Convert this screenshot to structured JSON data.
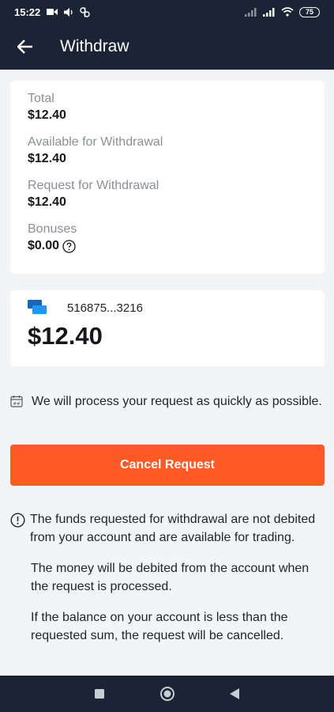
{
  "status_bar": {
    "time": "15:22",
    "battery": "75"
  },
  "app_bar": {
    "title": "Withdraw"
  },
  "summary": {
    "total_label": "Total",
    "total_value": "$12.40",
    "available_label": "Available for Withdrawal",
    "available_value": "$12.40",
    "request_label": "Request for Withdrawal",
    "request_value": "$12.40",
    "bonuses_label": "Bonuses",
    "bonuses_value": "$0.00"
  },
  "method": {
    "card_number": "516875...3216",
    "amount": "$12.40"
  },
  "process_note": "We will process your request as quickly as possible.",
  "cancel_button": "Cancel Request",
  "info": {
    "p1": "The funds requested for withdrawal are not debited from your account and are available for trading.",
    "p2": "The money will be debited from the account when the request is processed.",
    "p3": "If the balance on your account is less than the requested sum, the request will be cancelled."
  },
  "colors": {
    "header_bg": "#1b2435",
    "accent": "#ff5a24",
    "page_bg": "#f3f4f6"
  }
}
